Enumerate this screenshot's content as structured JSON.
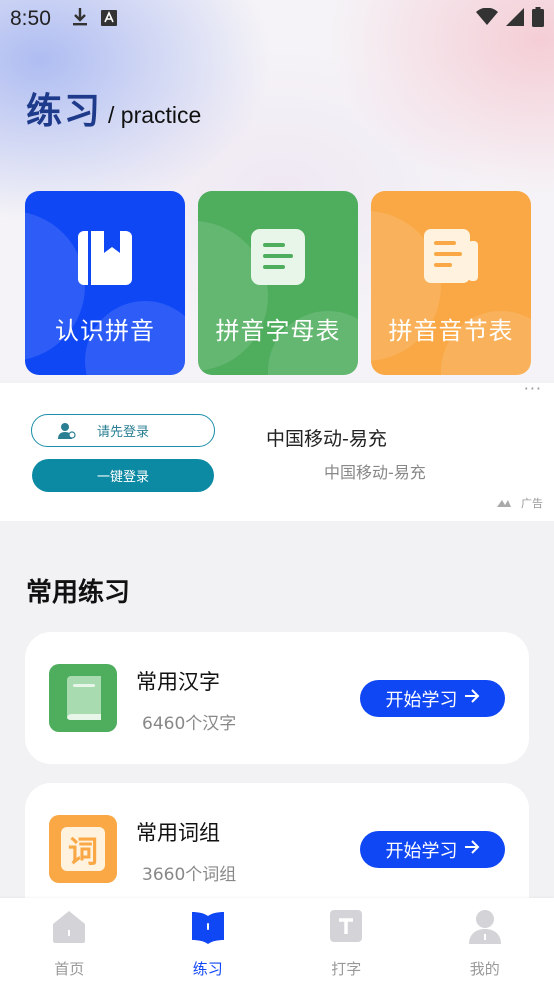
{
  "status_bar": {
    "time": "8:50"
  },
  "header": {
    "title_zh": "练习",
    "title_en": "/ practice"
  },
  "cards": [
    {
      "label": "认识拼音",
      "color": "#1047f5",
      "icon": "book-bookmark-icon"
    },
    {
      "label": "拼音字母表",
      "color": "#4fad5e",
      "icon": "list-doc-icon"
    },
    {
      "label": "拼音音节表",
      "color": "#f9a845",
      "icon": "notes-icon"
    }
  ],
  "ad": {
    "login_prompt": "请先登录",
    "one_click_login": "一键登录",
    "title": "中国移动-易充",
    "subtitle": "中国移动-易充",
    "tag": "广告"
  },
  "section": {
    "title": "常用练习"
  },
  "practice_items": [
    {
      "name": "常用汉字",
      "count": "6460个汉字",
      "button": "开始学习",
      "icon_color": "#4fad5e",
      "icon": "green-book-icon"
    },
    {
      "name": "常用词组",
      "count": "3660个词组",
      "button": "开始学习",
      "icon_color": "#f9a845",
      "icon_glyph": "词",
      "icon": "word-ci-icon"
    }
  ],
  "tabs": [
    {
      "label": "首页",
      "icon": "home-icon",
      "active": false
    },
    {
      "label": "练习",
      "icon": "book-open-icon",
      "active": true
    },
    {
      "label": "打字",
      "icon": "typing-t-icon",
      "active": false
    },
    {
      "label": "我的",
      "icon": "profile-icon",
      "active": false
    }
  ],
  "colors": {
    "accent": "#1047f5",
    "teal": "#0d8aa3"
  }
}
